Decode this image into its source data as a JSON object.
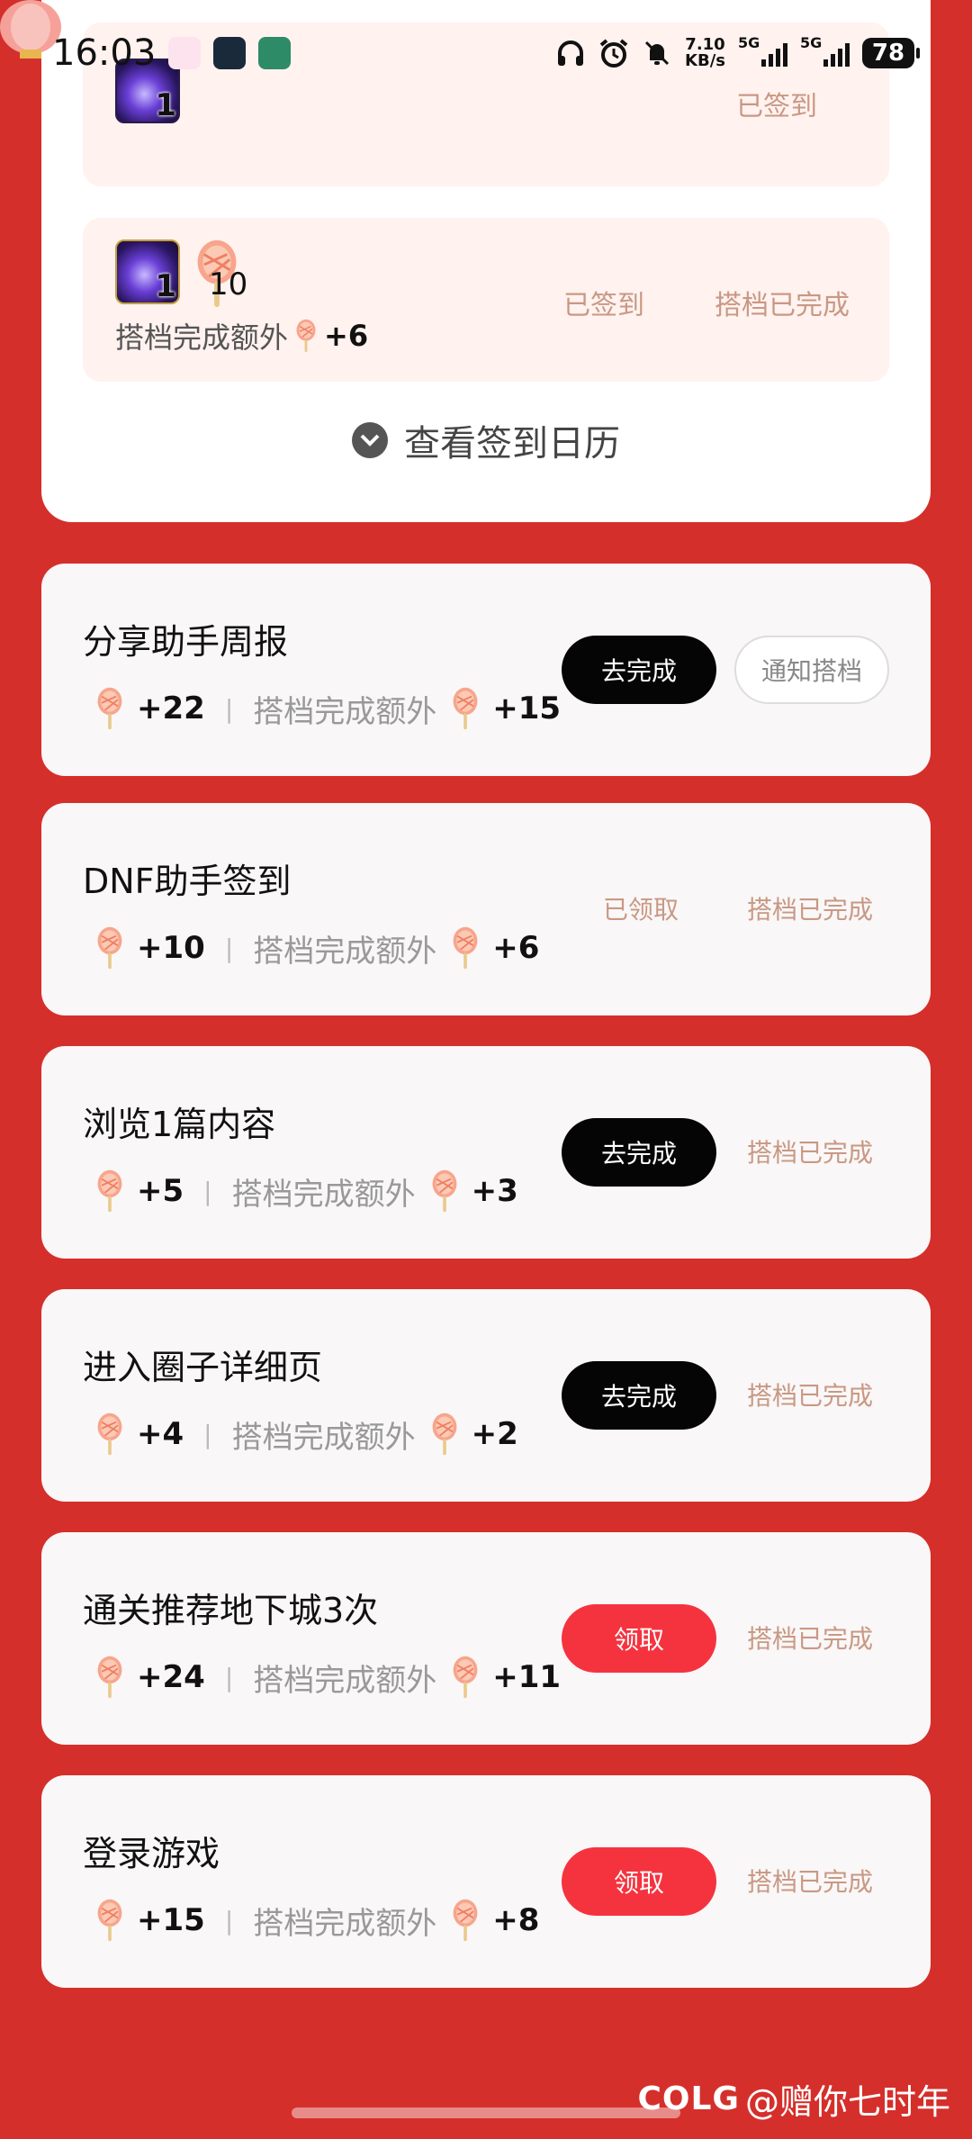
{
  "status_bar": {
    "time": "16:03",
    "net_speed_value": "7.10",
    "net_speed_unit": "KB/s",
    "sim1": "5G",
    "sim2": "5G",
    "battery": "78"
  },
  "checkin": {
    "rows": [
      {
        "reward_count": "1",
        "status": "已签到"
      },
      {
        "reward_count": "1",
        "lolly_count": "10",
        "status": "已签到",
        "partner_status": "搭档已完成",
        "extra_label": "搭档完成额外",
        "extra_value": "+6"
      }
    ],
    "calendar_link": "查看签到日历"
  },
  "tasks": [
    {
      "title": "分享助手周报",
      "reward": "+22",
      "extra_label": "搭档完成额外",
      "extra_reward": "+15",
      "primary": "去完成",
      "secondary": "通知搭档"
    },
    {
      "title": "DNF助手签到",
      "reward": "+10",
      "extra_label": "搭档完成额外",
      "extra_reward": "+6",
      "status": "已领取",
      "secondary": "搭档已完成"
    },
    {
      "title": "浏览1篇内容",
      "reward": "+5",
      "extra_label": "搭档完成额外",
      "extra_reward": "+3",
      "primary": "去完成",
      "secondary": "搭档已完成"
    },
    {
      "title": "进入圈子详细页",
      "reward": "+4",
      "extra_label": "搭档完成额外",
      "extra_reward": "+2",
      "primary": "去完成",
      "secondary": "搭档已完成"
    },
    {
      "title": "通关推荐地下城3次",
      "reward": "+24",
      "extra_label": "搭档完成额外",
      "extra_reward": "+11",
      "primary": "领取",
      "secondary": "搭档已完成"
    },
    {
      "title": "登录游戏",
      "reward": "+15",
      "extra_label": "搭档完成额外",
      "extra_reward": "+8",
      "primary": "领取",
      "secondary": "搭档已完成"
    }
  ],
  "watermark": {
    "logo": "COLG",
    "handle": "@赠你七时年"
  },
  "colors": {
    "background": "#d52f2b",
    "dark_button": "#050505",
    "red_button": "#f5333f",
    "muted_status": "#c99884"
  }
}
